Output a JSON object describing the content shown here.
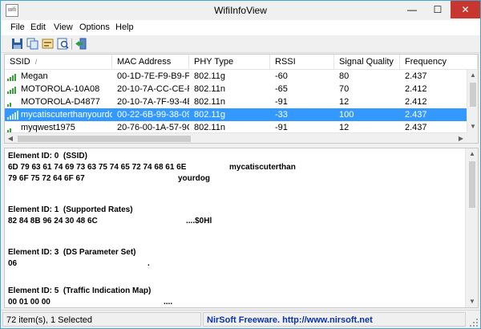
{
  "window": {
    "title": "WifiInfoView",
    "app_icon_label": "wifi",
    "controls": {
      "minimize": "—",
      "maximize": "☐",
      "close": "✕"
    }
  },
  "menu": [
    "File",
    "Edit",
    "View",
    "Options",
    "Help"
  ],
  "toolbar": {
    "buttons": [
      "save-icon",
      "copy-icon",
      "properties-icon",
      "find-icon",
      "exit-icon"
    ]
  },
  "list": {
    "columns": [
      "SSID",
      "MAC Address",
      "PHY Type",
      "RSSI",
      "Signal Quality",
      "Frequency"
    ],
    "sort_indicator": "/",
    "rows": [
      {
        "ssid": "Megan",
        "mac": "00-1D-7E-F9-B9-FA",
        "phy": "802.11g",
        "rssi": "-60",
        "quality": "80",
        "freq": "2.437",
        "bars": 4
      },
      {
        "ssid": "MOTOROLA-10A08",
        "mac": "20-10-7A-CC-CE-F1",
        "phy": "802.11n",
        "rssi": "-65",
        "quality": "70",
        "freq": "2.412",
        "bars": 4
      },
      {
        "ssid": "MOTOROLA-D4877",
        "mac": "20-10-7A-7F-93-4B",
        "phy": "802.11n",
        "rssi": "-91",
        "quality": "12",
        "freq": "2.412",
        "bars": 2
      },
      {
        "ssid": "mycatiscuterthanyourdog",
        "mac": "00-22-6B-99-38-09",
        "phy": "802.11g",
        "rssi": "-33",
        "quality": "100",
        "freq": "2.437",
        "bars": 5
      },
      {
        "ssid": "myqwest1975",
        "mac": "20-76-00-1A-57-9C",
        "phy": "802.11n",
        "rssi": "-91",
        "quality": "12",
        "freq": "2.437",
        "bars": 2
      }
    ],
    "selected_index": 3
  },
  "details": {
    "e0_title": "Element ID: 0  (SSID)",
    "e0_hex1": "6D 79 63 61 74 69 73 63 75 74 65 72 74 68 61 6E",
    "e0_ascii1": "mycatiscuterthan",
    "e0_hex2": "79 6F 75 72 64 6F 67",
    "e0_ascii2": "yourdog",
    "e1_title": "Element ID: 1  (Supported Rates)",
    "e1_hex": "82 84 8B 96 24 30 48 6C",
    "e1_ascii": "....$0Hl",
    "e3_title": "Element ID: 3  (DS Parameter Set)",
    "e3_hex": "06",
    "e3_ascii": ".",
    "e5_title": "Element ID: 5  (Traffic Indication Map)",
    "e5_hex": "00 01 00 00",
    "e5_ascii": "...."
  },
  "status": {
    "count": "72 item(s), 1 Selected",
    "credit": "NirSoft Freeware.  http://www.nirsoft.net"
  },
  "colors": {
    "selection": "#3399ff",
    "close_button": "#c7372f",
    "link": "#0d33a6",
    "signal_bars": "#38a038"
  }
}
